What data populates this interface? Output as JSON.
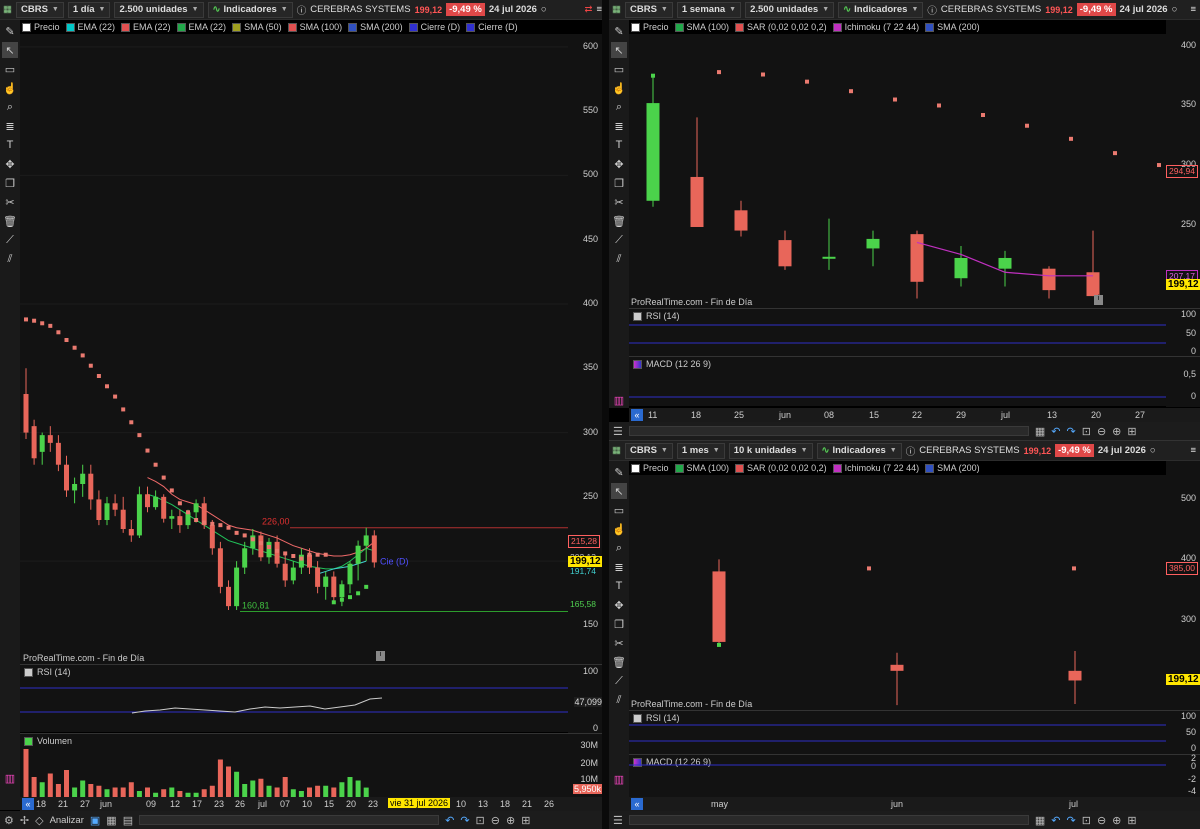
{
  "colors": {
    "up": "#4bd34b",
    "down": "#e8665a",
    "sar": "#ea7a70",
    "ema_green": "#21c35a",
    "ema_red": "#f06a6a",
    "rsi_line": "#cccccc",
    "band": "#2e2ec6",
    "price_tag": "#ffe600",
    "accent_blue": "#2a6ad0"
  },
  "left": {
    "symbol": "CBRS",
    "interval": "1 día",
    "units": "2.500 unidades",
    "indicators_label": "Indicadores",
    "company": "CEREBRAS SYSTEMS",
    "price": "199,12",
    "change": "-9,49 %",
    "date": "24 jul 2026",
    "legend": [
      {
        "label": "Precio",
        "color": "#ffffff"
      },
      {
        "label": "EMA (22)",
        "color": "#00c8c8"
      },
      {
        "label": "EMA (22)",
        "color": "#e05050"
      },
      {
        "label": "EMA (22)",
        "color": "#21a84a"
      },
      {
        "label": "SMA (50)",
        "color": "#a0a020"
      },
      {
        "label": "SMA (100)",
        "color": "#e05050"
      },
      {
        "label": "SMA (200)",
        "color": "#3050c0"
      },
      {
        "label": "Cierre (D)",
        "color": "#3030d0"
      },
      {
        "label": "Cierre (D)",
        "color": "#3030d0"
      }
    ],
    "y_ticks": [
      "600",
      "550",
      "500",
      "450",
      "400",
      "350",
      "300",
      "250",
      "200",
      "150"
    ],
    "y_values": [
      600,
      550,
      500,
      450,
      400,
      350,
      300,
      250,
      200,
      150
    ],
    "tags": [
      {
        "text": "215,28",
        "kind": "red",
        "value": 215.28
      },
      {
        "text": "202,13",
        "kind": "plain",
        "value": 202.13
      },
      {
        "text": "199,12",
        "kind": "yellow",
        "value": 199.12
      },
      {
        "text": "191,74",
        "kind": "cyan",
        "value": 191.74
      },
      {
        "text": "165,58",
        "kind": "green",
        "value": 165.58
      }
    ],
    "annotations": {
      "high": "226,00",
      "low": "160,81",
      "cierre": "Cie (D)"
    },
    "footer": "ProRealTime.com - Fin de Día",
    "rsi_label": "RSI (14)",
    "rsi_ticks": [
      "100",
      "47,099",
      "0"
    ],
    "volume_label": "Volumen",
    "volume_ticks": [
      "30M",
      "20M",
      "10M",
      "5,950k"
    ],
    "x_labels": [
      "18",
      "21",
      "27",
      "jun",
      "09",
      "12",
      "17",
      "23",
      "26",
      "jul",
      "07",
      "10",
      "15",
      "20",
      "23",
      "vie 31 jul 2026",
      "10",
      "13",
      "18",
      "21",
      "26"
    ],
    "x_highlight": "vie 31 jul 2026",
    "bottom": {
      "analyze": "Analizar"
    }
  },
  "top_right": {
    "symbol": "CBRS",
    "interval": "1 semana",
    "units": "2.500 unidades",
    "indicators_label": "Indicadores",
    "company": "CEREBRAS SYSTEMS",
    "price": "199,12",
    "change": "-9,49 %",
    "date": "24 jul 2026",
    "legend": [
      {
        "label": "Precio",
        "color": "#ffffff"
      },
      {
        "label": "SMA (100)",
        "color": "#21a84a"
      },
      {
        "label": "SAR (0,02 0,02 0,2)",
        "color": "#e05050"
      },
      {
        "label": "Ichimoku (7 22 44)",
        "color": "#c030c0"
      },
      {
        "label": "SMA (200)",
        "color": "#3050c0"
      }
    ],
    "y_ticks": [
      "400",
      "350",
      "300",
      "250",
      "200"
    ],
    "y_values": [
      400,
      350,
      300,
      250,
      200
    ],
    "tags": [
      {
        "text": "294,94",
        "kind": "red",
        "value": 294.94
      },
      {
        "text": "207,17",
        "kind": "magenta",
        "value": 207.17
      },
      {
        "text": "199,12",
        "kind": "yellow",
        "value": 199.12
      }
    ],
    "footer": "ProRealTime.com - Fin de Día",
    "rsi_label": "RSI (14)",
    "rsi_ticks": [
      "100",
      "50",
      "0"
    ],
    "macd_label": "MACD (12 26 9)",
    "macd_ticks": [
      "0,5",
      "0"
    ],
    "x_labels": [
      "11",
      "18",
      "25",
      "jun",
      "08",
      "15",
      "22",
      "29",
      "jul",
      "13",
      "20",
      "27"
    ]
  },
  "bottom_right": {
    "symbol": "CBRS",
    "interval": "1 mes",
    "units": "10 k unidades",
    "indicators_label": "Indicadores",
    "company": "CEREBRAS SYSTEMS",
    "price": "199,12",
    "change": "-9,49 %",
    "date": "24 jul 2026",
    "legend": [
      {
        "label": "Precio",
        "color": "#ffffff"
      },
      {
        "label": "SMA (100)",
        "color": "#21a84a"
      },
      {
        "label": "SAR (0,02 0,02 0,2)",
        "color": "#e05050"
      },
      {
        "label": "Ichimoku (7 22 44)",
        "color": "#c030c0"
      },
      {
        "label": "SMA (200)",
        "color": "#3050c0"
      }
    ],
    "y_ticks": [
      "500",
      "400",
      "300",
      "200"
    ],
    "y_values": [
      500,
      400,
      300,
      200
    ],
    "tags": [
      {
        "text": "385,00",
        "kind": "red",
        "value": 385
      },
      {
        "text": "199,12",
        "kind": "yellow",
        "value": 199.12
      }
    ],
    "footer": "ProRealTime.com - Fin de Día",
    "rsi_label": "RSI (14)",
    "rsi_ticks": [
      "100",
      "50",
      "0"
    ],
    "macd_label": "MACD (12 26 9)",
    "macd_ticks": [
      "2",
      "0",
      "-2",
      "-4"
    ],
    "x_labels": [
      "may",
      "jun",
      "jul"
    ]
  },
  "chart_data": [
    {
      "type": "candlestick",
      "name": "CBRS daily",
      "ylim": [
        120,
        610
      ],
      "candles": [
        {
          "o": 330,
          "h": 350,
          "l": 295,
          "c": 300
        },
        {
          "o": 305,
          "h": 310,
          "l": 275,
          "c": 280
        },
        {
          "o": 285,
          "h": 300,
          "l": 275,
          "c": 298
        },
        {
          "o": 298,
          "h": 305,
          "l": 285,
          "c": 292
        },
        {
          "o": 292,
          "h": 298,
          "l": 270,
          "c": 275
        },
        {
          "o": 275,
          "h": 282,
          "l": 250,
          "c": 255
        },
        {
          "o": 255,
          "h": 265,
          "l": 245,
          "c": 260
        },
        {
          "o": 260,
          "h": 275,
          "l": 250,
          "c": 268
        },
        {
          "o": 268,
          "h": 275,
          "l": 240,
          "c": 248
        },
        {
          "o": 248,
          "h": 255,
          "l": 228,
          "c": 232
        },
        {
          "o": 232,
          "h": 250,
          "l": 228,
          "c": 245
        },
        {
          "o": 245,
          "h": 252,
          "l": 235,
          "c": 240
        },
        {
          "o": 240,
          "h": 250,
          "l": 222,
          "c": 225
        },
        {
          "o": 225,
          "h": 232,
          "l": 215,
          "c": 220
        },
        {
          "o": 220,
          "h": 258,
          "l": 218,
          "c": 252
        },
        {
          "o": 252,
          "h": 258,
          "l": 238,
          "c": 242
        },
        {
          "o": 242,
          "h": 255,
          "l": 240,
          "c": 250
        },
        {
          "o": 250,
          "h": 252,
          "l": 230,
          "c": 233
        },
        {
          "o": 233,
          "h": 240,
          "l": 225,
          "c": 235
        },
        {
          "o": 235,
          "h": 240,
          "l": 222,
          "c": 228
        },
        {
          "o": 228,
          "h": 240,
          "l": 225,
          "c": 238
        },
        {
          "o": 238,
          "h": 248,
          "l": 230,
          "c": 245
        },
        {
          "o": 245,
          "h": 250,
          "l": 225,
          "c": 228
        },
        {
          "o": 228,
          "h": 232,
          "l": 205,
          "c": 210
        },
        {
          "o": 210,
          "h": 215,
          "l": 175,
          "c": 180
        },
        {
          "o": 180,
          "h": 185,
          "l": 162,
          "c": 165
        },
        {
          "o": 165,
          "h": 200,
          "l": 162,
          "c": 195
        },
        {
          "o": 195,
          "h": 215,
          "l": 190,
          "c": 210
        },
        {
          "o": 210,
          "h": 225,
          "l": 205,
          "c": 220
        },
        {
          "o": 220,
          "h": 223,
          "l": 200,
          "c": 203
        },
        {
          "o": 203,
          "h": 218,
          "l": 198,
          "c": 215
        },
        {
          "o": 215,
          "h": 220,
          "l": 195,
          "c": 198
        },
        {
          "o": 198,
          "h": 205,
          "l": 180,
          "c": 185
        },
        {
          "o": 185,
          "h": 200,
          "l": 182,
          "c": 195
        },
        {
          "o": 195,
          "h": 210,
          "l": 190,
          "c": 205
        },
        {
          "o": 205,
          "h": 210,
          "l": 190,
          "c": 195
        },
        {
          "o": 195,
          "h": 200,
          "l": 175,
          "c": 180
        },
        {
          "o": 180,
          "h": 192,
          "l": 170,
          "c": 188
        },
        {
          "o": 188,
          "h": 192,
          "l": 168,
          "c": 172
        },
        {
          "o": 172,
          "h": 185,
          "l": 165,
          "c": 182
        },
        {
          "o": 182,
          "h": 200,
          "l": 175,
          "c": 198
        },
        {
          "o": 198,
          "h": 216,
          "l": 185,
          "c": 212
        },
        {
          "o": 212,
          "h": 226,
          "l": 200,
          "c": 220
        },
        {
          "o": 220,
          "h": 224,
          "l": 195,
          "c": 199
        }
      ],
      "sar": [
        388,
        387,
        385,
        383,
        378,
        372,
        366,
        360,
        352,
        344,
        336,
        328,
        318,
        308,
        298,
        286,
        275,
        265,
        255,
        245,
        238,
        232,
        230,
        229,
        228,
        226,
        222,
        220,
        217,
        214,
        211,
        208,
        206,
        204,
        202,
        205,
        205,
        205,
        168,
        170,
        172,
        175,
        180
      ],
      "volume_m": [
        28,
        12,
        9,
        14,
        8,
        16,
        6,
        10,
        8,
        7,
        5,
        6,
        6,
        9,
        4,
        6,
        3,
        5,
        6,
        4,
        3,
        3,
        5,
        7,
        22,
        18,
        15,
        8,
        10,
        11,
        7,
        6,
        12,
        5,
        4,
        6,
        7,
        7,
        6,
        9,
        12,
        10,
        5.95
      ]
    },
    {
      "type": "candlestick",
      "name": "CBRS weekly",
      "ylim": [
        180,
        410
      ],
      "candles": [
        {
          "o": 270,
          "h": 375,
          "l": 265,
          "c": 352
        },
        {
          "o": 290,
          "h": 340,
          "l": 278,
          "c": 248
        },
        {
          "o": 262,
          "h": 270,
          "l": 240,
          "c": 245
        },
        {
          "o": 237,
          "h": 245,
          "l": 212,
          "c": 215
        },
        {
          "o": 222,
          "h": 255,
          "l": 212,
          "c": 223
        },
        {
          "o": 230,
          "h": 245,
          "l": 215,
          "c": 238
        },
        {
          "o": 242,
          "h": 245,
          "l": 188,
          "c": 202
        },
        {
          "o": 205,
          "h": 232,
          "l": 198,
          "c": 222
        },
        {
          "o": 213,
          "h": 228,
          "l": 198,
          "c": 222
        },
        {
          "o": 213,
          "h": 215,
          "l": 188,
          "c": 195
        },
        {
          "o": 210,
          "h": 245,
          "l": 190,
          "c": 190
        }
      ],
      "sar": [
        375,
        378,
        376,
        370,
        362,
        355,
        350,
        342,
        333,
        322,
        310,
        300
      ],
      "ichimoku": [
        null,
        null,
        null,
        null,
        null,
        null,
        235,
        225,
        210,
        207,
        207
      ]
    },
    {
      "type": "candlestick",
      "name": "CBRS monthly",
      "ylim": [
        150,
        540
      ],
      "candles": [
        {
          "o": 380,
          "h": 400,
          "l": 258,
          "c": 263
        },
        {
          "o": 225,
          "h": 245,
          "l": 158,
          "c": 215
        },
        {
          "o": 215,
          "h": 248,
          "l": 160,
          "c": 199
        }
      ],
      "sar": [
        258,
        385,
        385
      ]
    }
  ]
}
